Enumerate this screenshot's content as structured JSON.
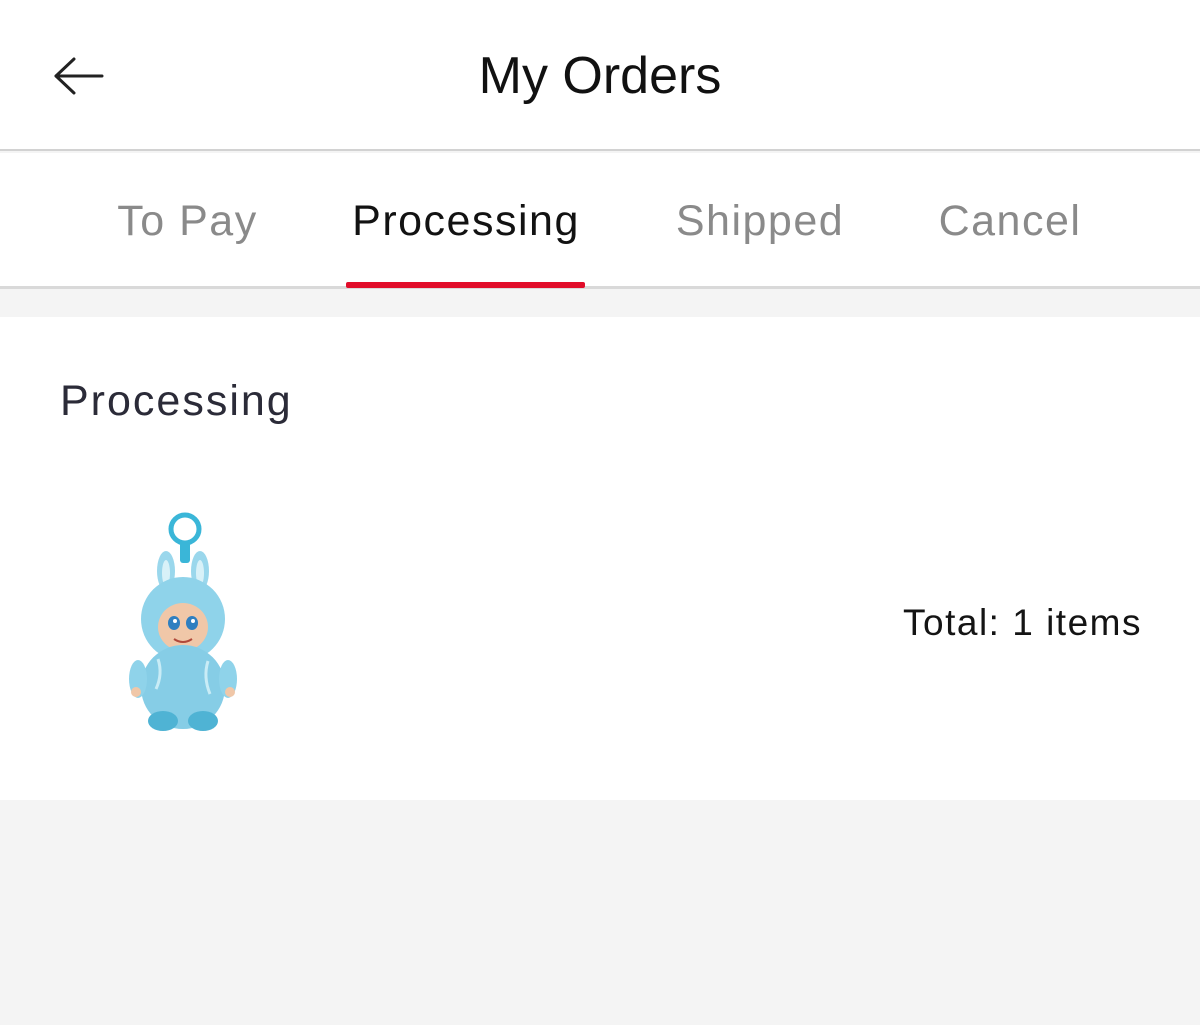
{
  "header": {
    "title": "My Orders",
    "back_icon": "arrow-left-icon"
  },
  "tabs": [
    {
      "label": "To Pay",
      "active": false
    },
    {
      "label": "Processing",
      "active": true
    },
    {
      "label": "Shipped",
      "active": false
    },
    {
      "label": "Cancel",
      "active": false
    }
  ],
  "order": {
    "status": "Processing",
    "product_image": "blue-plush-doll-keychain",
    "total": "Total: 1 items"
  },
  "colors": {
    "accent": "#e10d2a",
    "background": "#f4f4f4",
    "tab_inactive": "#8a8a8a",
    "product_blue": "#8fd3ea"
  }
}
